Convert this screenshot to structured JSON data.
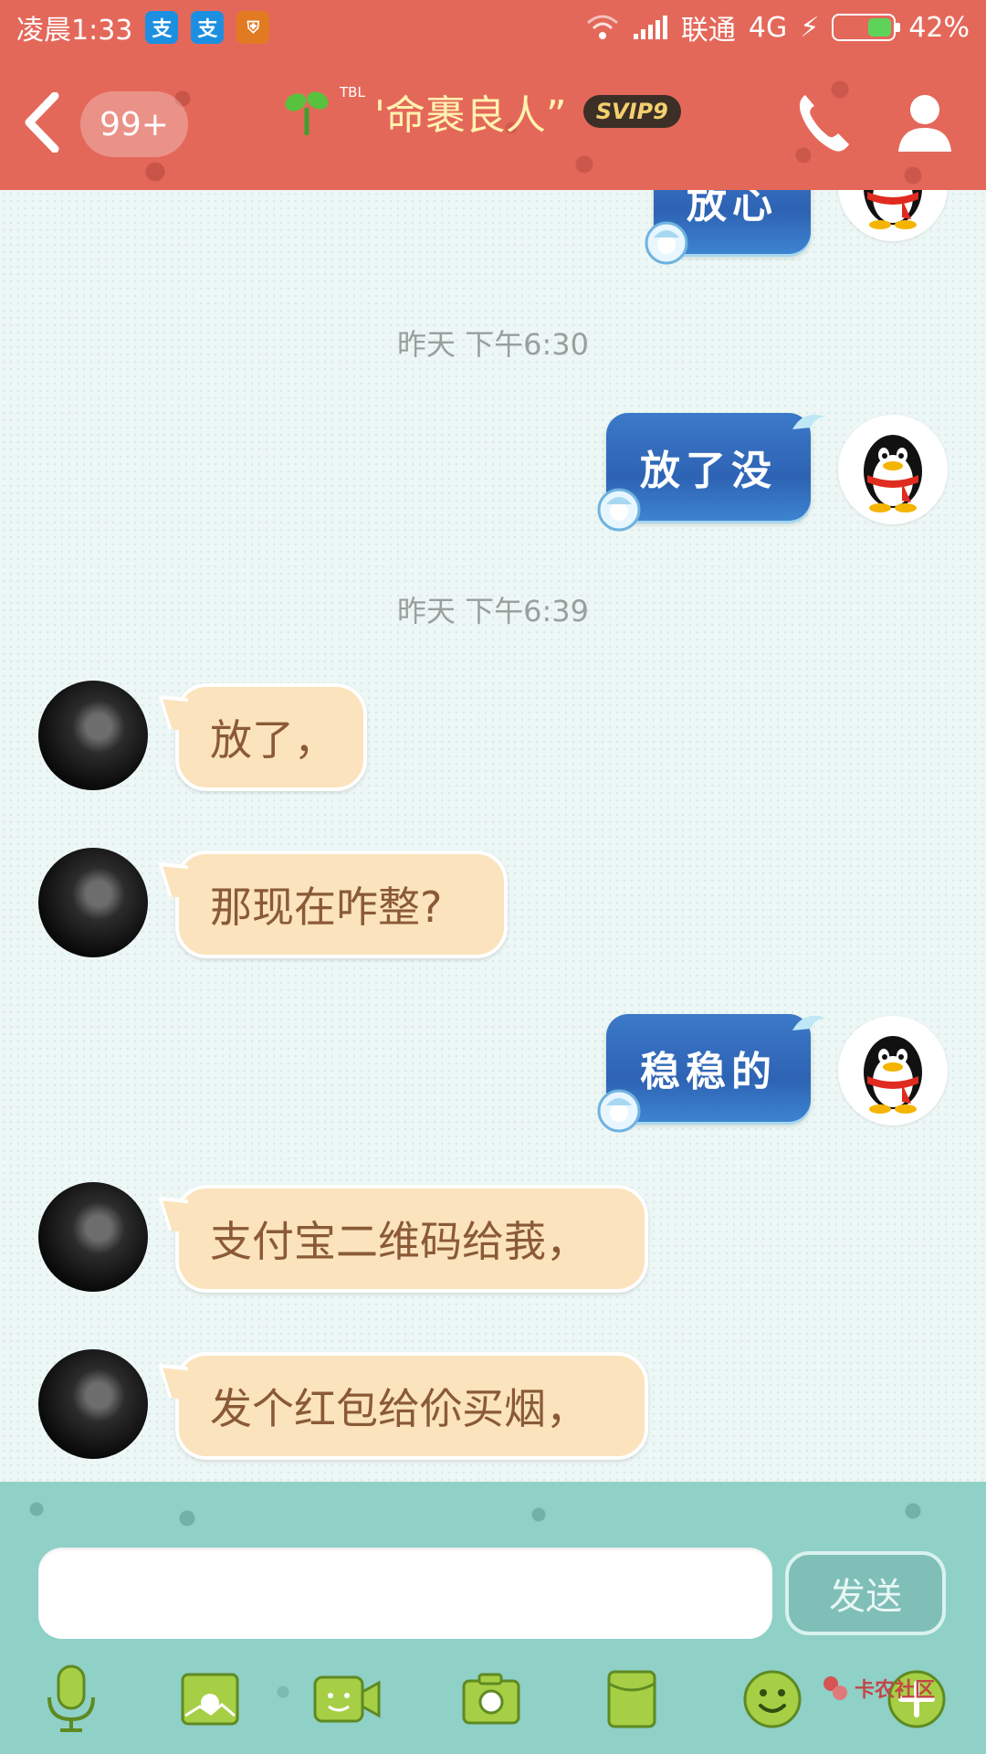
{
  "status_bar": {
    "time": "凌晨1:33",
    "carrier": "联通",
    "network": "4G",
    "battery_percent": "42%",
    "battery_level": 0.42,
    "app_icons": [
      "alipay-icon",
      "alipay-icon",
      "shield-app-icon"
    ]
  },
  "header": {
    "unread_count": "99+",
    "title_prefix": "TBL",
    "title": "'命裹良人”",
    "vip_badge": "SVIP9",
    "colors": {
      "bar": "#e4685a",
      "title": "#fff3b0"
    }
  },
  "chat": {
    "messages": [
      {
        "side": "me",
        "text": "放心",
        "partial": true
      },
      {
        "type": "timestamp",
        "text": "昨天 下午6:30"
      },
      {
        "side": "me",
        "text": "放了没"
      },
      {
        "type": "timestamp",
        "text": "昨天 下午6:39"
      },
      {
        "side": "them",
        "text": "放了，"
      },
      {
        "side": "them",
        "text": "那现在咋整?"
      },
      {
        "side": "me",
        "text": "稳稳的"
      },
      {
        "side": "them",
        "text": "支付宝二维码给莪，"
      },
      {
        "side": "them",
        "text": "发个红包给伱买烟，"
      }
    ],
    "colors": {
      "incoming_bubble": "#fbe3bd",
      "incoming_text": "#8a5a36",
      "outgoing_bubble": "#2e63b4"
    }
  },
  "input_bar": {
    "placeholder": "",
    "send_label": "发送",
    "tools": [
      "microphone-icon",
      "photo-icon",
      "video-call-icon",
      "camera-icon",
      "red-packet-icon",
      "emoji-icon",
      "plus-icon"
    ],
    "watermark": "卡农社区"
  }
}
